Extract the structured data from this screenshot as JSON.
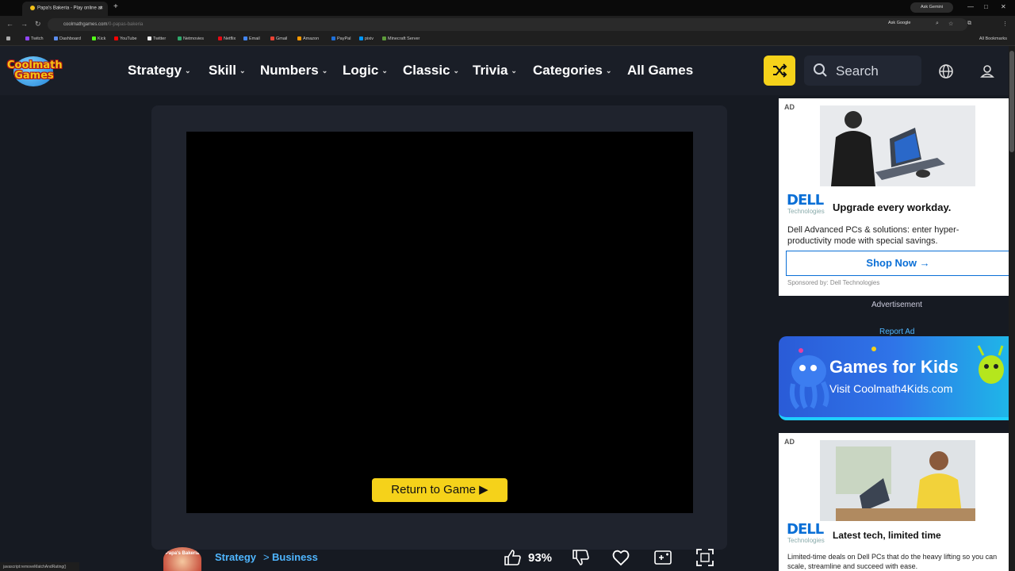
{
  "browser": {
    "tab_title": "Papa's Bakeria - Play online at",
    "tab_close": "×",
    "new_tab": "+",
    "ask_gemini": "Ask Gemini",
    "url_main": "coolmathgames.com",
    "url_rest": "/0-papas-bakeria",
    "ask_google": "Ask Google",
    "bookmarks": [
      "Twitch",
      "Dashboard",
      "Kick",
      "YouTube",
      "Twitter",
      "Netmovies",
      "Netflix",
      "Email",
      "Gmail",
      "Amazon",
      "PayPal",
      "pixiv",
      "Minecraft Server"
    ],
    "all_bookmarks": "All Bookmarks",
    "status_text": "javascript:removeMatchAndRating()"
  },
  "header": {
    "logo_line1": "Coolmath",
    "logo_line2": "Games",
    "nav": [
      "Strategy",
      "Skill",
      "Numbers",
      "Logic",
      "Classic",
      "Trivia",
      "Categories",
      "All Games"
    ],
    "chevron": "⌄",
    "search_placeholder": "Search"
  },
  "game": {
    "return_label": "Return to Game ▶",
    "thumb_label": "Papa's Bakeria",
    "breadcrumb_category": "Strategy",
    "breadcrumb_sep": ">",
    "breadcrumb_sub": "Business",
    "like_percent": "93%"
  },
  "ads": {
    "ad_tag": "AD",
    "dell": "DELL",
    "dell_sub": "Technologies",
    "ad1_head": "Upgrade every workday.",
    "ad1_body": "Dell Advanced PCs & solutions: enter hyper-productivity mode with special savings.",
    "ad1_cta": "Shop Now →",
    "ad1_sponsor": "Sponsored by: Dell Technologies",
    "advertisement": "Advertisement",
    "report_ad": "Report Ad",
    "kids_title": "Games for Kids",
    "kids_sub": "Visit Coolmath4Kids.com",
    "ad2_head": "Latest tech, limited time",
    "ad2_body": "Limited-time deals on Dell PCs that do the heavy lifting so you can scale, streamline and succeed with ease."
  },
  "colors": {
    "accent_yellow": "#f5d21a",
    "link_blue": "#4fb6ff",
    "dell_blue": "#0a6fd6",
    "page_bg": "#161a22"
  }
}
